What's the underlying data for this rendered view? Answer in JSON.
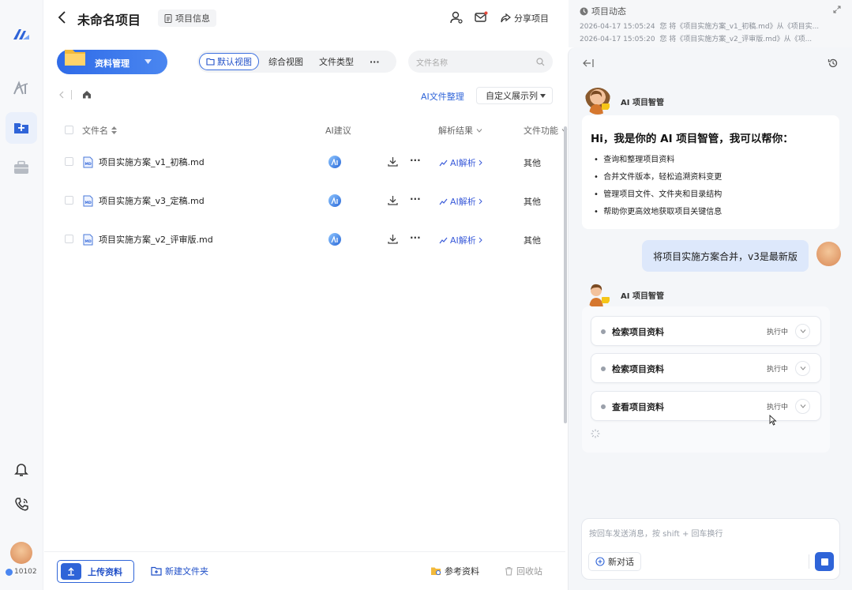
{
  "header": {
    "back_icon": "chevron-left-icon",
    "title": "未命名项目",
    "info_button": "项目信息",
    "share_label": "分享项目"
  },
  "toolbar": {
    "manager_label": "资料管理",
    "view_tabs": [
      "默认视图",
      "综合视图",
      "文件类型"
    ],
    "more": "···",
    "search_placeholder": "文件名称",
    "ai_organize": "AI文件整理",
    "custom_columns": "自定义展示列"
  },
  "table": {
    "headers": [
      "文件名",
      "AI建议",
      "解析结果",
      "文件功能"
    ],
    "rows": [
      {
        "name": "项目实施方案_v1_初稿.md",
        "parse": "AI解析",
        "function": "其他"
      },
      {
        "name": "项目实施方案_v3_定稿.md",
        "parse": "AI解析",
        "function": "其他"
      },
      {
        "name": "项目实施方案_v2_评审版.md",
        "parse": "AI解析",
        "function": "其他"
      }
    ]
  },
  "bottom": {
    "upload": "上传资料",
    "new_folder": "新建文件夹",
    "reference": "参考资料",
    "recycle": "回收站",
    "user_id": "10102"
  },
  "activity": {
    "title": "项目动态",
    "items": [
      {
        "time": "2026-04-17 15:05:24",
        "text": "您 将《项目实施方案_v1_初稿.md》从《项目实..."
      },
      {
        "time": "2026-04-17 15:05:20",
        "text": "您 将《项目实施方案_v2_评审版.md》从《项..."
      }
    ]
  },
  "assistant": {
    "name": "AI 项目智管",
    "greeting": "Hi，我是你的 AI 项目智管，我可以帮你：",
    "bullets": [
      "查询和整理项目资料",
      "合并文件版本，轻松追溯资料变更",
      "管理项目文件、文件夹和目录结构",
      "帮助你更高效地获取项目关键信息"
    ],
    "user_message": "将项目实施方案合并，v3是最新版",
    "steps": [
      {
        "label": "检索项目资料",
        "status": "执行中"
      },
      {
        "label": "检索项目资料",
        "status": "执行中"
      },
      {
        "label": "查看项目资料",
        "status": "执行中"
      }
    ],
    "input_placeholder": "按回车发送消息，按 shift + 回车换行",
    "new_chat": "新对话"
  },
  "colors": {
    "primary": "#2f64d8",
    "accent_gradient_end": "#4a86f0",
    "panel_bg": "#f4f6f9"
  }
}
